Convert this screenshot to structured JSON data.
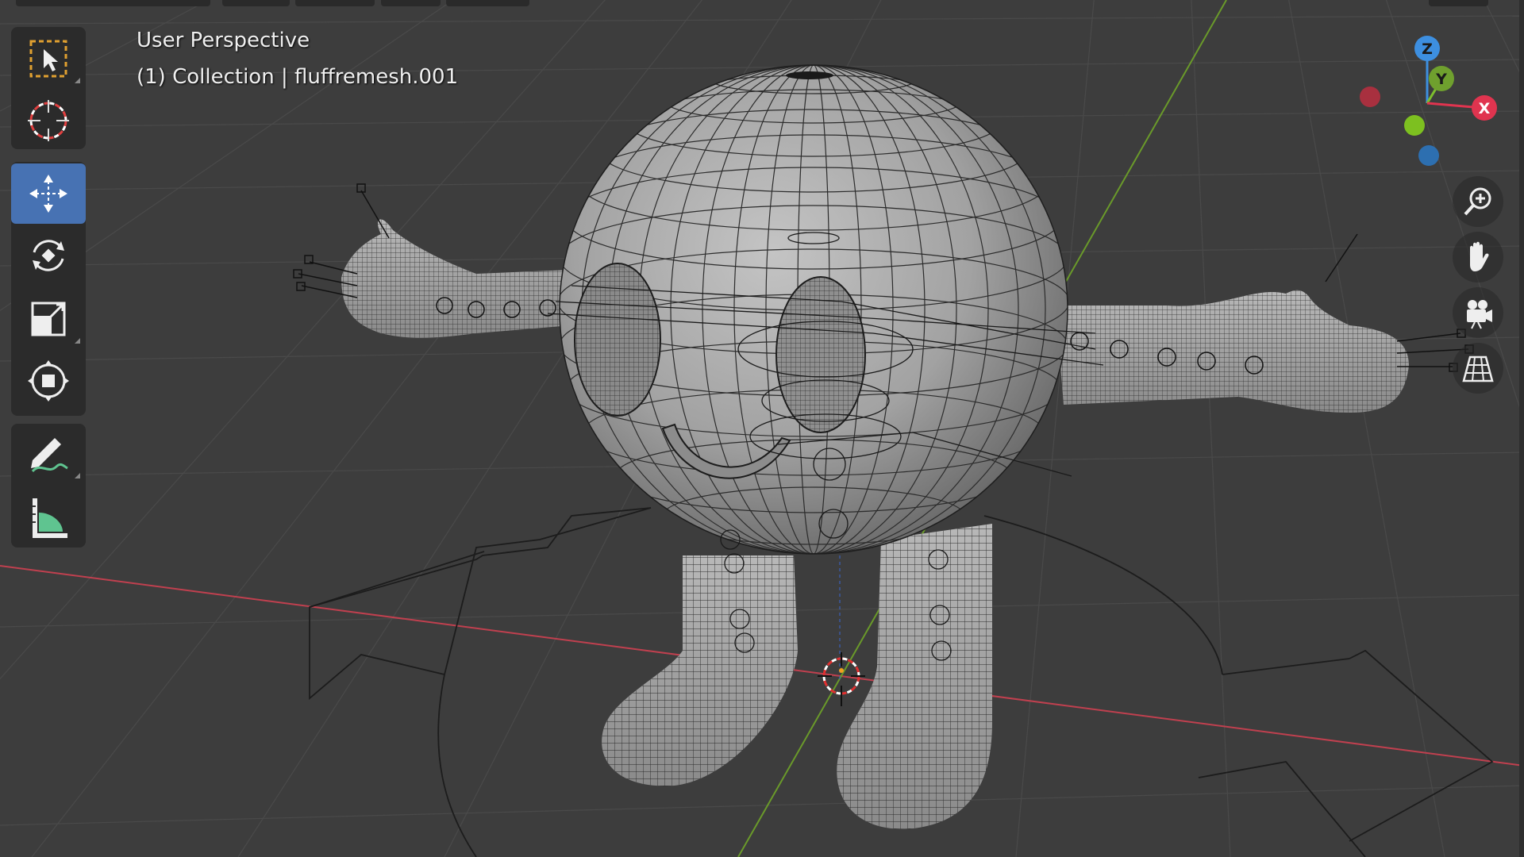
{
  "viewport": {
    "view_name": "User Perspective",
    "collection_info": "(1) Collection | fluffremesh.001"
  },
  "toolbar": {
    "tools": [
      {
        "name": "select-box",
        "icon": "select-box-icon",
        "active": false
      },
      {
        "name": "cursor",
        "icon": "cursor-icon",
        "active": false
      },
      {
        "name": "move",
        "icon": "move-icon",
        "active": true
      },
      {
        "name": "rotate",
        "icon": "rotate-icon",
        "active": false
      },
      {
        "name": "scale",
        "icon": "scale-icon",
        "active": false
      },
      {
        "name": "transform",
        "icon": "transform-icon",
        "active": false
      },
      {
        "name": "annotate",
        "icon": "annotate-icon",
        "active": false
      },
      {
        "name": "measure",
        "icon": "measure-icon",
        "active": false
      }
    ]
  },
  "gizmo": {
    "z_label": "Z",
    "y_label": "Y",
    "x_label": "X"
  },
  "navigation": {
    "buttons": [
      "zoom-icon",
      "pan-hand-icon",
      "camera-icon",
      "grid-view-icon"
    ]
  },
  "colors": {
    "active_tool": "#4772b3",
    "axis_x": "#e0344f",
    "axis_y": "#7dbe2e",
    "axis_z": "#3d8fe0",
    "background": "#3d3d3d"
  }
}
